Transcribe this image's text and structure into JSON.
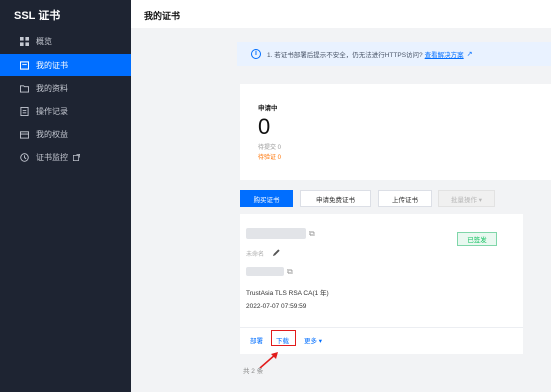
{
  "sidebar": {
    "brand": "SSL 证书",
    "items": [
      {
        "label": "概览",
        "icon": "grid-icon",
        "active": false
      },
      {
        "label": "我的证书",
        "icon": "certificate-icon",
        "active": true
      },
      {
        "label": "我的资料",
        "icon": "folder-icon",
        "active": false
      },
      {
        "label": "操作记录",
        "icon": "record-icon",
        "active": false
      },
      {
        "label": "我的权益",
        "icon": "benefit-icon",
        "active": false
      },
      {
        "label": "证书监控",
        "icon": "monitor-icon",
        "active": false
      }
    ]
  },
  "header": {
    "title": "我的证书"
  },
  "notice": {
    "text": "1. 若证书部署后提示不安全，仍无法进行HTTPS访问?",
    "link": "查看解决方案"
  },
  "stats": {
    "label": "申请中",
    "value": "0",
    "pending_submit": "待提交 0",
    "pending_verify": "待验证 0"
  },
  "toolbar": {
    "buy": "购买证书",
    "apply_free": "申请免费证书",
    "upload": "上传证书",
    "batch": "批量操作 ▾"
  },
  "cert": {
    "status": "已签发",
    "note": "未命名",
    "type": "TrustAsia TLS RSA CA(1 年)",
    "date": "2022-07-07 07:59:59",
    "actions": {
      "deploy": "部署",
      "download": "下载",
      "more": "更多 ▾"
    }
  },
  "footer": {
    "total": "共 2 条"
  },
  "colors": {
    "accent": "#006eff",
    "sidebar": "#1e2432",
    "success": "#0abf5b",
    "warning": "#ff7200",
    "highlight": "#e21b1b"
  }
}
